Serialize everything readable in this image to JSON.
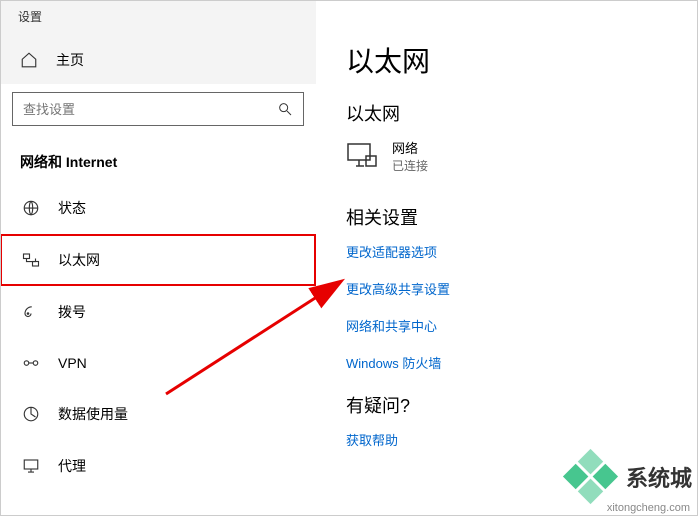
{
  "window_title": "设置",
  "home_label": "主页",
  "search": {
    "placeholder": "查找设置"
  },
  "category_header": "网络和 Internet",
  "nav": [
    {
      "label": "状态",
      "icon": "status-icon"
    },
    {
      "label": "以太网",
      "icon": "ethernet-icon"
    },
    {
      "label": "拨号",
      "icon": "dialup-icon"
    },
    {
      "label": "VPN",
      "icon": "vpn-icon"
    },
    {
      "label": "数据使用量",
      "icon": "data-usage-icon"
    },
    {
      "label": "代理",
      "icon": "proxy-icon"
    }
  ],
  "selected_nav_index": 1,
  "page": {
    "title": "以太网",
    "adapter_section": "以太网",
    "network": {
      "name": "网络",
      "status": "已连接"
    },
    "related_header": "相关设置",
    "links": [
      "更改适配器选项",
      "更改高级共享设置",
      "网络和共享中心",
      "Windows 防火墙"
    ],
    "help_header": "有疑问?",
    "help_link": "获取帮助"
  },
  "watermark": {
    "brand": "系统城",
    "url": "xitongcheng.com"
  }
}
